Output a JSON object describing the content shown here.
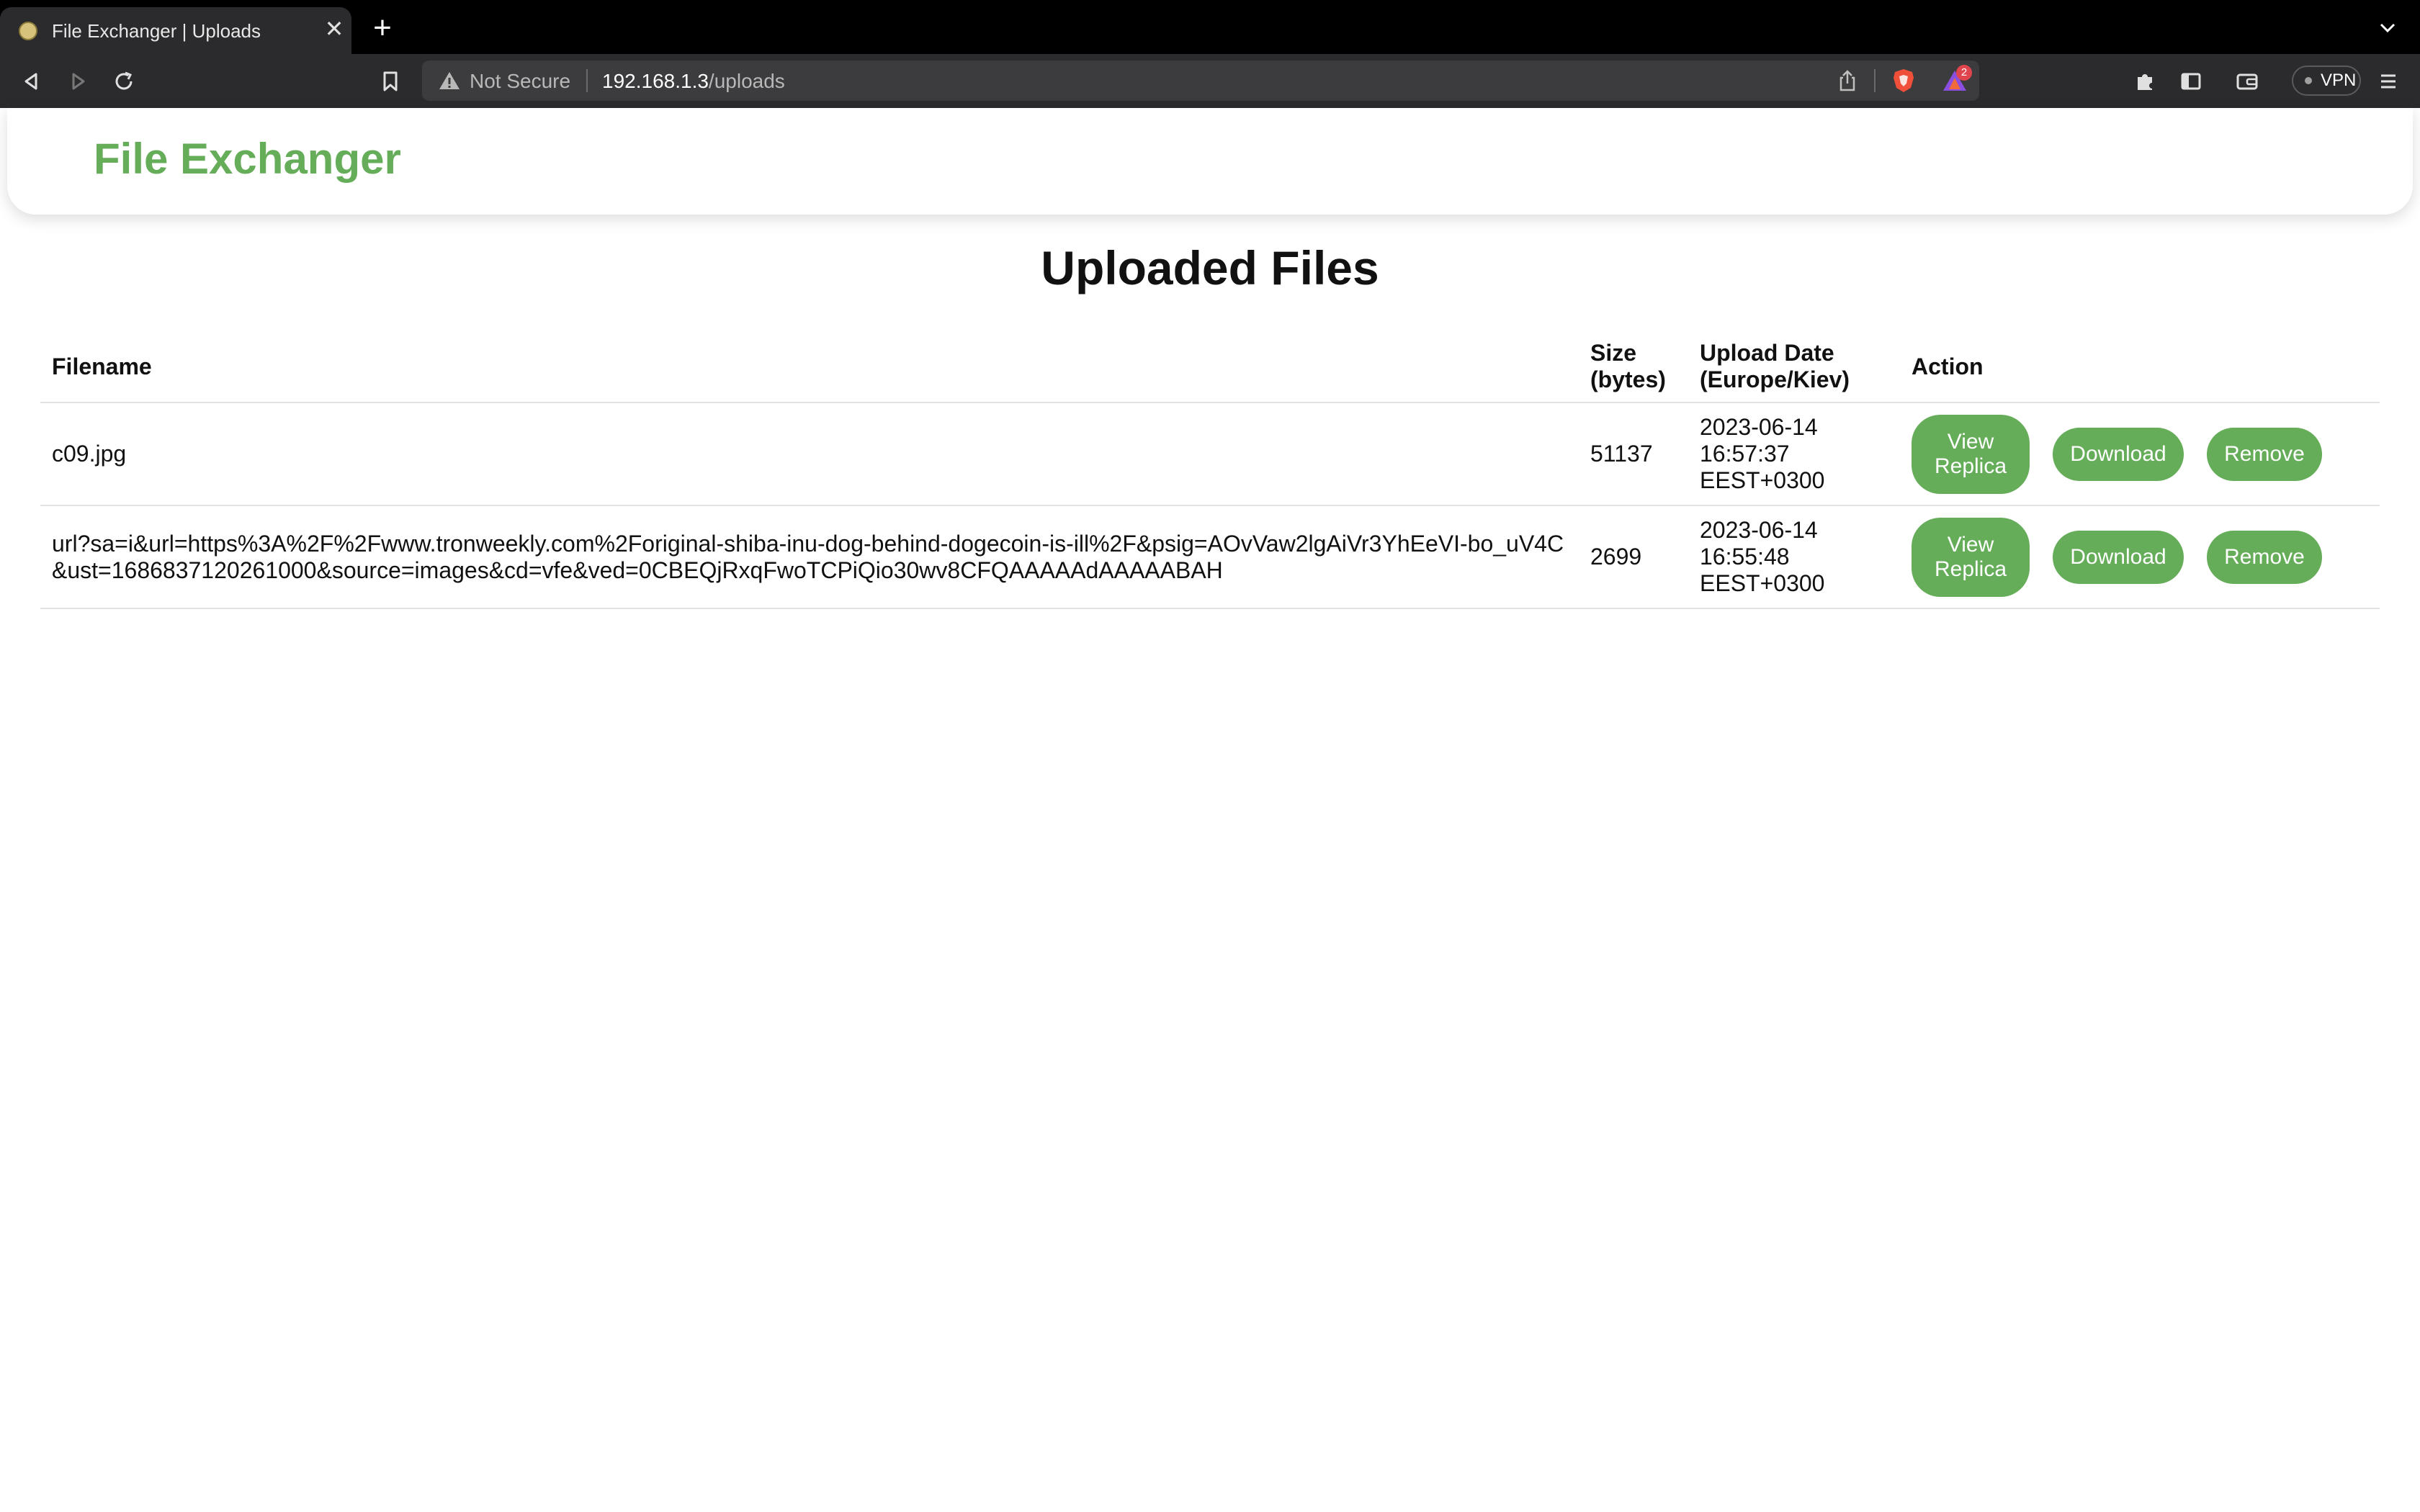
{
  "browser": {
    "tab": {
      "title": "File Exchanger | Uploads"
    },
    "new_tab_label": "+",
    "close_label": "✕",
    "address": {
      "security": "Not Secure",
      "host": "192.168.1.3",
      "path": "/uploads"
    },
    "rewards_count": "2",
    "vpn_label": "VPN"
  },
  "site": {
    "brand": "File Exchanger",
    "brand_color": "#66ad5a"
  },
  "page": {
    "title": "Uploaded Files",
    "columns": {
      "filename": "Filename",
      "size": "Size (bytes)",
      "date": "Upload Date (Europe/Kiev)",
      "action": "Action"
    },
    "buttons": {
      "view": "View Replica",
      "download": "Download",
      "remove": "Remove"
    },
    "rows": [
      {
        "filename": "c09.jpg",
        "size": "51137",
        "date": "2023-06-14 16:57:37 EEST+0300"
      },
      {
        "filename": "url?sa=i&url=https%3A%2F%2Fwww.tronweekly.com%2Foriginal-shiba-inu-dog-behind-dogecoin-is-ill%2F&psig=AOvVaw2lgAiVr3YhEeVI-bo_uV4C&ust=1686837120261000&source=images&cd=vfe&ved=0CBEQjRxqFwoTCPiQio30wv8CFQAAAAAdAAAAABAH",
        "size": "2699",
        "date": "2023-06-14 16:55:48 EEST+0300"
      }
    ]
  }
}
